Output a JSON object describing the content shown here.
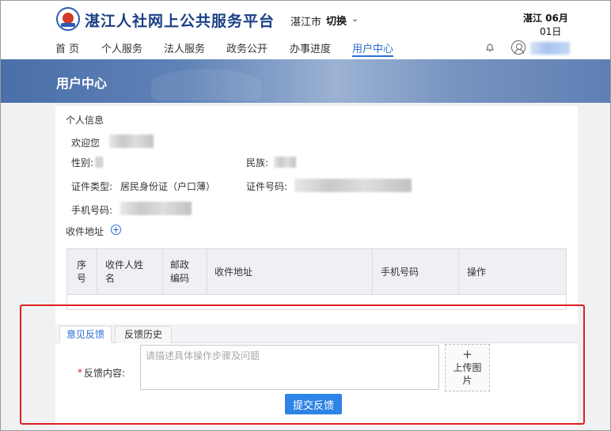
{
  "header": {
    "site_title": "湛江人社网上公共服务平台",
    "city": "湛江市",
    "switch_label": "切换",
    "date_line1": "湛江 06月",
    "date_line2": "01日"
  },
  "nav": {
    "items": [
      "首 页",
      "个人服务",
      "法人服务",
      "政务公开",
      "办事进度",
      "用户中心"
    ],
    "active": "用户中心"
  },
  "banner": {
    "title": "用户中心"
  },
  "personal_info": {
    "section_title": "个人信息",
    "welcome": "欢迎您",
    "gender_label": "性别:",
    "ethnicity_label": "民族:",
    "id_type_label": "证件类型:",
    "id_type_value": "居民身份证（户口薄）",
    "id_number_label": "证件号码:",
    "phone_label": "手机号码:"
  },
  "address": {
    "section_title": "收件地址",
    "columns": [
      {
        "line1": "序",
        "line2": "号"
      },
      {
        "line1": "收件人姓",
        "line2": "名"
      },
      {
        "line1": "邮政",
        "line2": "编码"
      },
      {
        "line1": "收件地址",
        "line2": ""
      },
      {
        "line1": "手机号码",
        "line2": ""
      },
      {
        "line1": "操作",
        "line2": ""
      }
    ]
  },
  "feedback": {
    "tabs": [
      "意见反馈",
      "反馈历史"
    ],
    "active_tab": "意见反馈",
    "required_mark": "*",
    "content_label": "反馈内容:",
    "placeholder": "请描述具体操作步骤及问题",
    "upload_plus": "+",
    "upload_label": "上传图片",
    "submit_label": "提交反馈"
  },
  "colors": {
    "brand_blue": "#1b3f86",
    "active_blue": "#2b6ed6",
    "button_blue": "#2e83e6",
    "highlight_red": "#e02020"
  }
}
